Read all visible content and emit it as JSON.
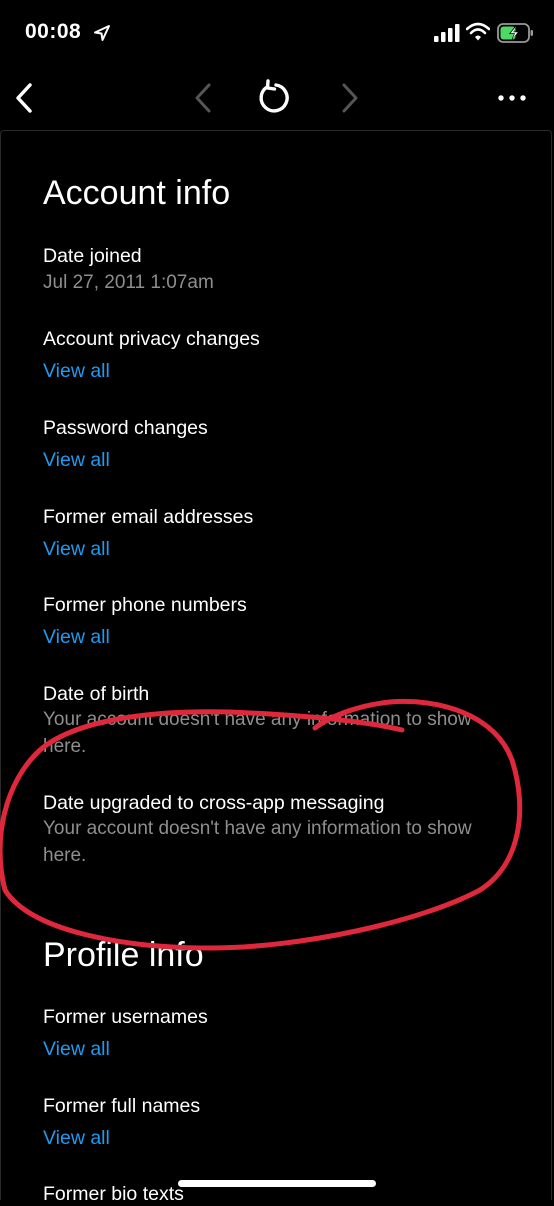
{
  "status": {
    "time": "00:08"
  },
  "account_section": {
    "title": "Account info",
    "date_joined": {
      "label": "Date joined",
      "value": "Jul 27, 2011 1:07am"
    },
    "privacy_changes": {
      "label": "Account privacy changes",
      "link": "View all"
    },
    "password_changes": {
      "label": "Password changes",
      "link": "View all"
    },
    "former_emails": {
      "label": "Former email addresses",
      "link": "View all"
    },
    "former_phones": {
      "label": "Former phone numbers",
      "link": "View all"
    },
    "date_of_birth": {
      "label": "Date of birth",
      "value": "Your account doesn't have any information to show here."
    },
    "cross_app": {
      "label": "Date upgraded to cross-app messaging",
      "value": "Your account doesn't have any information to show here."
    }
  },
  "profile_section": {
    "title": "Profile info",
    "former_usernames": {
      "label": "Former usernames",
      "link": "View all"
    },
    "former_full_names": {
      "label": "Former full names",
      "link": "View all"
    },
    "former_bio": {
      "label": "Former bio texts"
    }
  },
  "colors": {
    "link": "#1f9bf0",
    "annotation": "#e0283c",
    "muted": "#8e8e8e"
  }
}
